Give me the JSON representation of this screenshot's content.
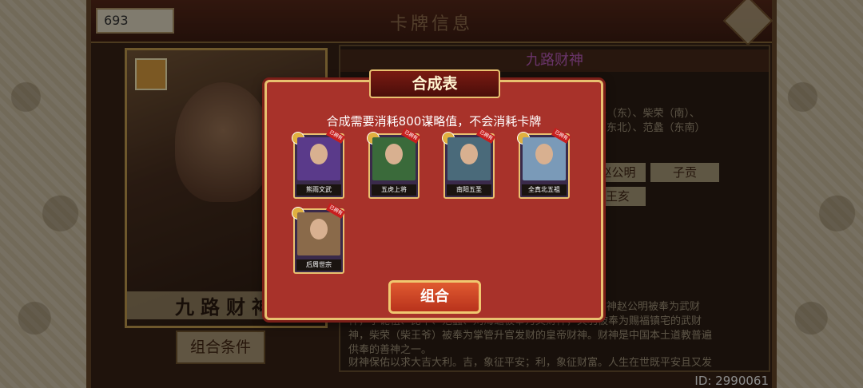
{
  "header": {
    "coins": "693",
    "title": "卡牌信息"
  },
  "portrait": {
    "name": "九路财神",
    "condition_button": "组合条件"
  },
  "right_panel": {
    "title": "九路财神",
    "lines": [
      "干（东）、柴荣（南）、",
      "（东北）、范蠡（东南）"
    ],
    "chips": [
      "赵公明",
      "子贡",
      "王亥"
    ],
    "desc": [
      "财神赵公明被奉为武财",
      "神，李诡祖、比干、范蠡、刘海蟾被奉为文财神，关羽被奉为赐福镇宅的武财",
      "神，柴荣（柴王爷）被奉为掌管升官发财的皇帝财神。财神是中国本土道教普遍",
      "供奉的善神之一。",
      "财神保佑以求大吉大利。吉，象征平安；利，象征财富。人生在世既平安且又发"
    ]
  },
  "dialog": {
    "title": "合成表",
    "message": "合成需要消耗800谋略值，不会消耗卡牌",
    "combine_button": "组合",
    "cards": [
      {
        "label": "熊雨文武",
        "ribbon": "已拥有",
        "art_color": "#5a3a8a"
      },
      {
        "label": "五虎上将",
        "ribbon": "已拥有",
        "art_color": "#3a6a3a"
      },
      {
        "label": "南阳五圣",
        "ribbon": "已拥有",
        "art_color": "#4a6a7a"
      },
      {
        "label": "全真北五祖",
        "ribbon": "已拥有",
        "art_color": "#7a9ab8"
      },
      {
        "label": "后周世宗",
        "ribbon": "已拥有",
        "art_color": "#8a6a4a"
      }
    ]
  },
  "footer": {
    "id_label": "ID: 2990061"
  }
}
